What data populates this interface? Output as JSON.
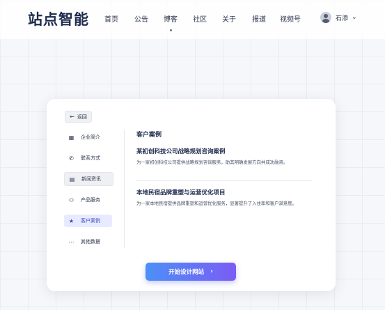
{
  "header": {
    "logo": "站点智能",
    "nav": [
      "首页",
      "公告",
      "博客",
      "社区",
      "关于",
      "报道",
      "视频号"
    ],
    "user_name": "石添",
    "chevron": "⌄"
  },
  "card": {
    "back_label": "返回",
    "sidebar": [
      {
        "icon": "building-icon",
        "label": "企业简介"
      },
      {
        "icon": "phone-icon",
        "label": "联系方式"
      },
      {
        "icon": "news-icon",
        "label": "新闻资讯"
      },
      {
        "icon": "handshake-icon",
        "label": "产品服务"
      },
      {
        "icon": "star-icon",
        "label": "客户案例"
      },
      {
        "icon": "more-icon",
        "label": "其他数据"
      }
    ],
    "active_item": "客户案例",
    "content": {
      "title": "客户案例",
      "cases": [
        {
          "title": "某初创科技公司战略规划咨询案例",
          "desc": "为一家初创科技公司提供战略规划咨询服务，助其明确发展方向并成功融资。"
        },
        {
          "title": "本地民宿品牌重塑与运营优化项目",
          "desc": "为一家本地民宿提供品牌重塑和运营优化服务，显著提升了入住率和客户满意度。"
        }
      ]
    },
    "cta_label": "开始设计网站",
    "cta_arrow": "›"
  },
  "colors": {
    "accent": "#3646c8",
    "cta_start": "#4d8ff7",
    "cta_end": "#7b5cf5"
  }
}
